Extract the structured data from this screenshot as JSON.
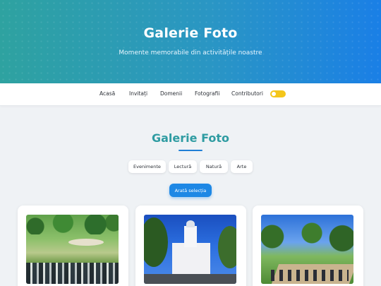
{
  "hero": {
    "title": "Galerie Foto",
    "subtitle": "Momente memorabile din activitățile noastre"
  },
  "nav": {
    "items": [
      {
        "label": "Acasă"
      },
      {
        "label": "Invitați"
      },
      {
        "label": "Domenii"
      },
      {
        "label": "Fotografii"
      },
      {
        "label": "Contributori"
      }
    ],
    "theme_toggle_icon": "toggle-switch"
  },
  "section": {
    "title": "Galerie Foto"
  },
  "filters": [
    {
      "label": "Evenimente"
    },
    {
      "label": "Lectură"
    },
    {
      "label": "Natură"
    },
    {
      "label": "Arte"
    }
  ],
  "cta": {
    "label": "Arată selecția"
  },
  "gallery": {
    "cards": [
      {
        "image": "park-amphitheatre-photo"
      },
      {
        "image": "cathedral-photo"
      },
      {
        "image": "park-path-photo"
      }
    ]
  },
  "colors": {
    "hero_gradient_start": "#2ea2a0",
    "hero_gradient_end": "#1a7fe6",
    "accent": "#2f9ca2",
    "button": "#1e88e5",
    "toggle": "#f4c61b",
    "background": "#eff2f5"
  }
}
